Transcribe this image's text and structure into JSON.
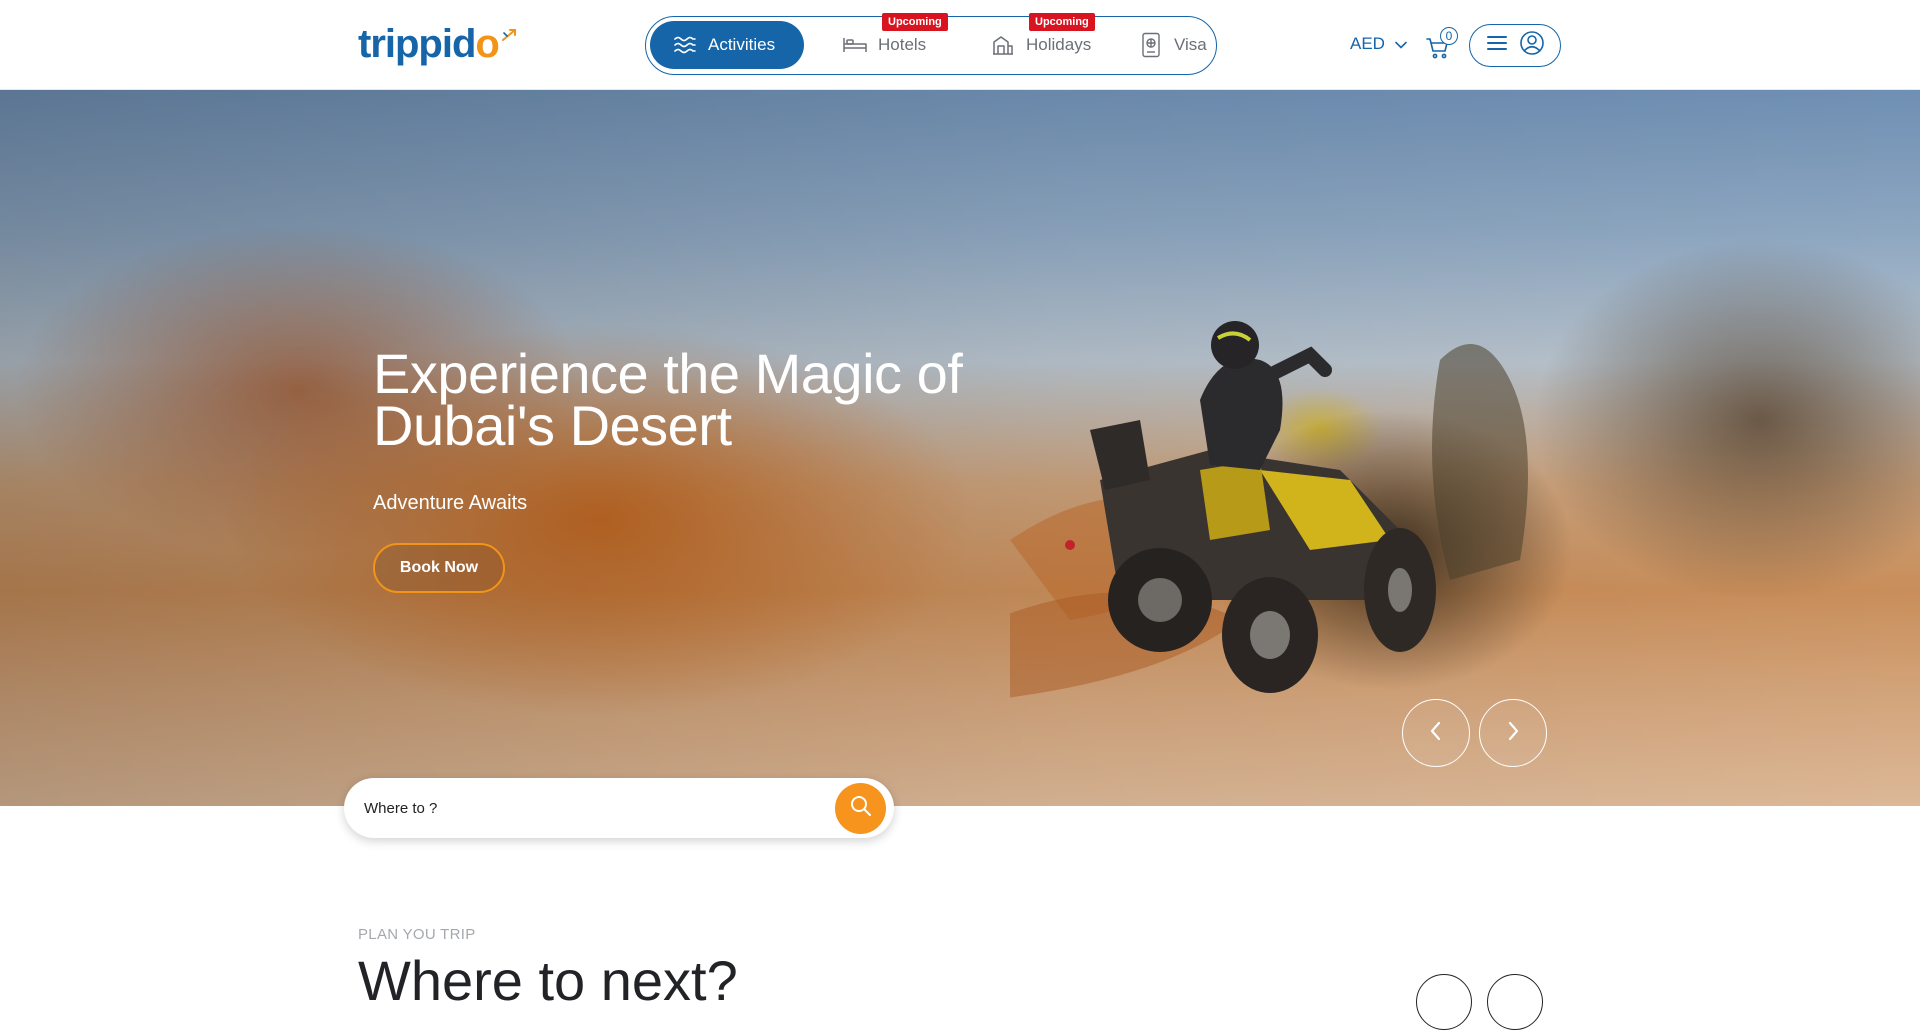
{
  "brand": {
    "logo_text_blue": "trippid",
    "logo_text_orange": "o",
    "logo_icon": "plane-icon",
    "colors": {
      "primary": "#1565a8",
      "accent": "#f29418",
      "badge": "#d7141f"
    }
  },
  "nav": {
    "tabs": [
      {
        "label": "Activities",
        "icon": "waves-icon",
        "active": true,
        "badge": ""
      },
      {
        "label": "Hotels",
        "icon": "bed-icon",
        "active": false,
        "badge": "Upcoming"
      },
      {
        "label": "Holidays",
        "icon": "building-icon",
        "active": false,
        "badge": "Upcoming"
      },
      {
        "label": "Visa",
        "icon": "passport-icon",
        "active": false,
        "badge": ""
      }
    ]
  },
  "header": {
    "currency": "AED",
    "currency_icon": "chevron-down-icon",
    "cart_count": "0",
    "cart_icon": "cart-icon",
    "menu_icon": "menu-icon",
    "user_icon": "user-icon"
  },
  "hero": {
    "title": "Experience the Magic of Dubai's Desert",
    "subtitle": "Adventure Awaits",
    "cta": "Book Now",
    "prev_icon": "chevron-left-icon",
    "next_icon": "chevron-right-icon"
  },
  "search": {
    "placeholder": "Where to ?",
    "icon": "search-icon"
  },
  "section": {
    "label": "PLAN YOU TRIP",
    "title": "Where to next?"
  }
}
